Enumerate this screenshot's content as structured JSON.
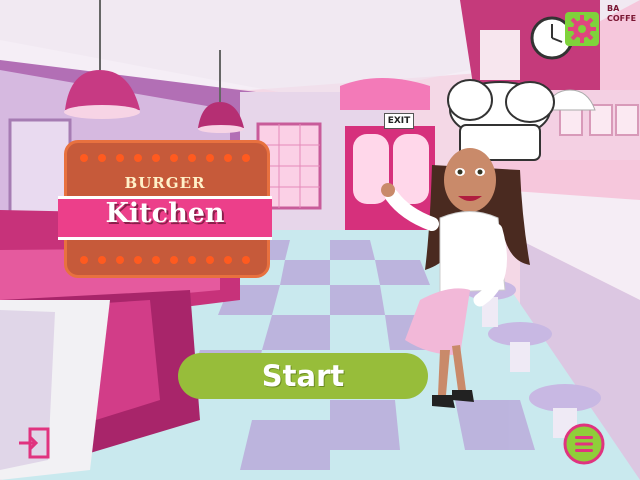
{
  "logo": {
    "line1": "BURGER",
    "line2": "Kitchen"
  },
  "start_button": {
    "label": "Start"
  },
  "signs": {
    "exit": "EXIT",
    "wall_lines": [
      "BA",
      "COFFE"
    ]
  },
  "icons": {
    "settings": "gear-icon",
    "exit": "exit-icon",
    "menu": "hamburger-menu-icon"
  },
  "colors": {
    "accent_pink": "#ec3f8a",
    "start_green": "#97bd3a",
    "logo_orange": "#c65a3a",
    "gear_green": "#7fd23b"
  }
}
